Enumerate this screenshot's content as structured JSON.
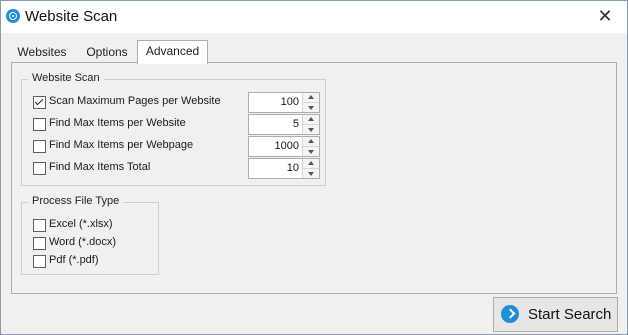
{
  "window": {
    "title": "Website Scan",
    "app_icon": "website-scan-logo-icon",
    "close_icon": "close-icon",
    "close_glyph": "✕"
  },
  "tabs": [
    {
      "label": "Websites",
      "active": false
    },
    {
      "label": "Options",
      "active": false
    },
    {
      "label": "Advanced",
      "active": true
    }
  ],
  "website_scan": {
    "title": "Website Scan",
    "rows": [
      {
        "label": "Scan Maximum Pages per Website",
        "checked": true,
        "value": "100"
      },
      {
        "label": "Find Max Items per Website",
        "checked": false,
        "value": "5"
      },
      {
        "label": "Find Max Items per Webpage",
        "checked": false,
        "value": "1000"
      },
      {
        "label": "Find Max Items Total",
        "checked": false,
        "value": "10"
      }
    ]
  },
  "process_file_type": {
    "title": "Process File Type",
    "items": [
      {
        "label": "Excel (*.xlsx)",
        "checked": false
      },
      {
        "label": "Word (*.docx)",
        "checked": false
      },
      {
        "label": "Pdf (*.pdf)",
        "checked": false
      }
    ]
  },
  "start_button": {
    "label": "Start Search",
    "icon": "arrow-right-icon"
  },
  "colors": {
    "accent": "#1e8fd6",
    "window_bg": "#f0f0f0",
    "border": "#adadad"
  }
}
